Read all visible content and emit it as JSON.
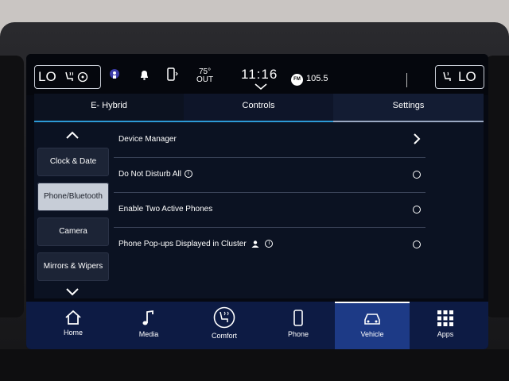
{
  "status": {
    "left_climate": "LO",
    "right_climate": "LO",
    "temp": "75°",
    "temp_sub": "OUT",
    "time": "11:16",
    "radio_band": "FM",
    "radio_freq": "105.5"
  },
  "tabs": [
    {
      "label": "E- Hybrid"
    },
    {
      "label": "Controls"
    },
    {
      "label": "Settings"
    }
  ],
  "nav": [
    {
      "label": "Clock & Date"
    },
    {
      "label": "Phone/Bluetooth"
    },
    {
      "label": "Camera"
    },
    {
      "label": "Mirrors & Wipers"
    }
  ],
  "rows": [
    {
      "label": "Device Manager"
    },
    {
      "label": "Do Not Disturb All"
    },
    {
      "label": "Enable Two Active Phones"
    },
    {
      "label": "Phone Pop-ups Displayed in Cluster"
    }
  ],
  "dock": [
    {
      "label": "Home",
      "icon": "home-icon"
    },
    {
      "label": "Media",
      "icon": "music-note-icon"
    },
    {
      "label": "Comfort",
      "icon": "comfort-icon"
    },
    {
      "label": "Phone",
      "icon": "phone-icon"
    },
    {
      "label": "Vehicle",
      "icon": "car-icon"
    },
    {
      "label": "Apps",
      "icon": "apps-grid-icon"
    }
  ],
  "colors": {
    "accent": "#2d9ad6",
    "dock_bg": "#0d1b44",
    "dock_active": "#1d3a86",
    "nav_active": "#c7cdd7"
  }
}
